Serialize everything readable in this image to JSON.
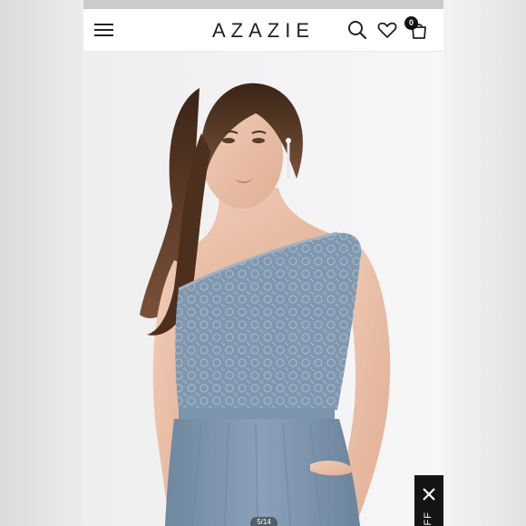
{
  "header": {
    "brand": "AZAZIE",
    "cart_count": "0"
  },
  "icons": {
    "menu": "hamburger-menu-icon",
    "search": "search-icon",
    "wishlist": "heart-icon",
    "cart": "shopping-bag-icon",
    "close": "close-icon"
  },
  "gallery": {
    "page_indicator": "5/14"
  },
  "promo": {
    "label": "OFF"
  },
  "colors": {
    "dress": "#7f98b2",
    "header_bg": "#ffffff",
    "text": "#222222",
    "promo_bg": "#141414"
  }
}
